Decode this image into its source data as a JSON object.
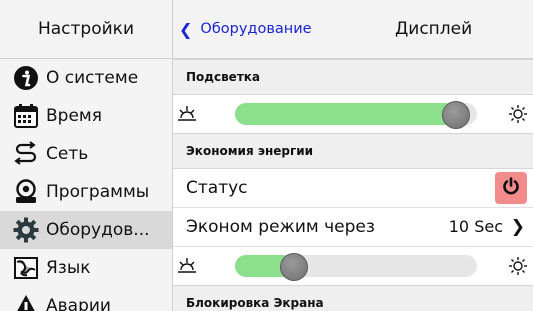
{
  "sidebar": {
    "title": "Настройки",
    "items": [
      {
        "label": "О системе",
        "icon": "info-icon"
      },
      {
        "label": "Время",
        "icon": "calendar-icon"
      },
      {
        "label": "Сеть",
        "icon": "network-icon"
      },
      {
        "label": "Программы",
        "icon": "programs-icon"
      },
      {
        "label": "Оборудов...",
        "icon": "gear-icon",
        "selected": true
      },
      {
        "label": "Язык",
        "icon": "map-icon"
      },
      {
        "label": "Аварии",
        "icon": "warning-icon"
      }
    ]
  },
  "header": {
    "back_label": "Оборудование",
    "title": "Дисплей"
  },
  "main": {
    "backlight": {
      "header": "Подсветка",
      "slider_level_percent": 91
    },
    "energy_saving": {
      "header": "Экономия энергии",
      "status_label": "Статус",
      "eco_label": "Эконом режим через",
      "eco_value": "10 Sec",
      "slider_level_percent": 24
    },
    "screen_lock": {
      "header": "Блокировка Экрана"
    }
  },
  "colors": {
    "accent": "#1a24d4",
    "slider_fill": "#8ce08c",
    "power_button": "#f28b8b",
    "selected_row": "#d9d9d9"
  }
}
